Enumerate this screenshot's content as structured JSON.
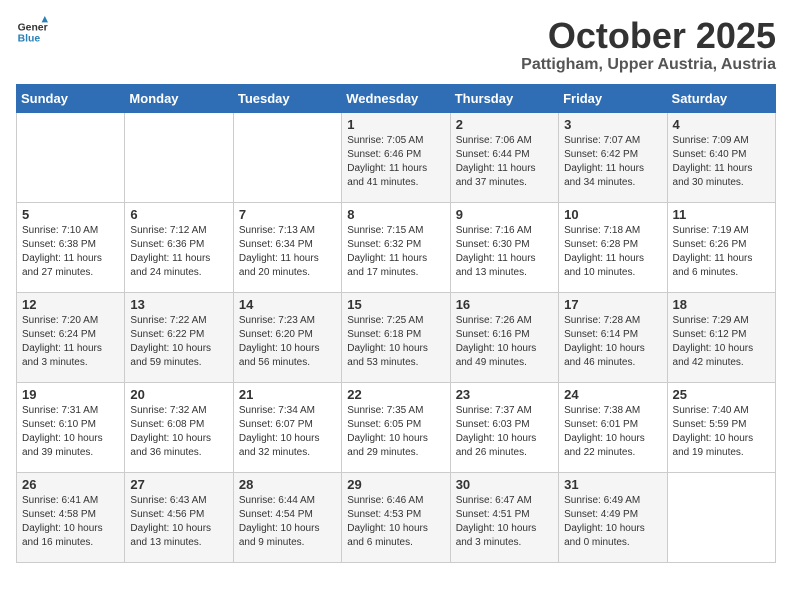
{
  "header": {
    "logo_line1": "General",
    "logo_line2": "Blue",
    "title": "October 2025",
    "subtitle": "Pattigham, Upper Austria, Austria"
  },
  "weekdays": [
    "Sunday",
    "Monday",
    "Tuesday",
    "Wednesday",
    "Thursday",
    "Friday",
    "Saturday"
  ],
  "weeks": [
    [
      {
        "day": "",
        "info": ""
      },
      {
        "day": "",
        "info": ""
      },
      {
        "day": "",
        "info": ""
      },
      {
        "day": "1",
        "info": "Sunrise: 7:05 AM\nSunset: 6:46 PM\nDaylight: 11 hours\nand 41 minutes."
      },
      {
        "day": "2",
        "info": "Sunrise: 7:06 AM\nSunset: 6:44 PM\nDaylight: 11 hours\nand 37 minutes."
      },
      {
        "day": "3",
        "info": "Sunrise: 7:07 AM\nSunset: 6:42 PM\nDaylight: 11 hours\nand 34 minutes."
      },
      {
        "day": "4",
        "info": "Sunrise: 7:09 AM\nSunset: 6:40 PM\nDaylight: 11 hours\nand 30 minutes."
      }
    ],
    [
      {
        "day": "5",
        "info": "Sunrise: 7:10 AM\nSunset: 6:38 PM\nDaylight: 11 hours\nand 27 minutes."
      },
      {
        "day": "6",
        "info": "Sunrise: 7:12 AM\nSunset: 6:36 PM\nDaylight: 11 hours\nand 24 minutes."
      },
      {
        "day": "7",
        "info": "Sunrise: 7:13 AM\nSunset: 6:34 PM\nDaylight: 11 hours\nand 20 minutes."
      },
      {
        "day": "8",
        "info": "Sunrise: 7:15 AM\nSunset: 6:32 PM\nDaylight: 11 hours\nand 17 minutes."
      },
      {
        "day": "9",
        "info": "Sunrise: 7:16 AM\nSunset: 6:30 PM\nDaylight: 11 hours\nand 13 minutes."
      },
      {
        "day": "10",
        "info": "Sunrise: 7:18 AM\nSunset: 6:28 PM\nDaylight: 11 hours\nand 10 minutes."
      },
      {
        "day": "11",
        "info": "Sunrise: 7:19 AM\nSunset: 6:26 PM\nDaylight: 11 hours\nand 6 minutes."
      }
    ],
    [
      {
        "day": "12",
        "info": "Sunrise: 7:20 AM\nSunset: 6:24 PM\nDaylight: 11 hours\nand 3 minutes."
      },
      {
        "day": "13",
        "info": "Sunrise: 7:22 AM\nSunset: 6:22 PM\nDaylight: 10 hours\nand 59 minutes."
      },
      {
        "day": "14",
        "info": "Sunrise: 7:23 AM\nSunset: 6:20 PM\nDaylight: 10 hours\nand 56 minutes."
      },
      {
        "day": "15",
        "info": "Sunrise: 7:25 AM\nSunset: 6:18 PM\nDaylight: 10 hours\nand 53 minutes."
      },
      {
        "day": "16",
        "info": "Sunrise: 7:26 AM\nSunset: 6:16 PM\nDaylight: 10 hours\nand 49 minutes."
      },
      {
        "day": "17",
        "info": "Sunrise: 7:28 AM\nSunset: 6:14 PM\nDaylight: 10 hours\nand 46 minutes."
      },
      {
        "day": "18",
        "info": "Sunrise: 7:29 AM\nSunset: 6:12 PM\nDaylight: 10 hours\nand 42 minutes."
      }
    ],
    [
      {
        "day": "19",
        "info": "Sunrise: 7:31 AM\nSunset: 6:10 PM\nDaylight: 10 hours\nand 39 minutes."
      },
      {
        "day": "20",
        "info": "Sunrise: 7:32 AM\nSunset: 6:08 PM\nDaylight: 10 hours\nand 36 minutes."
      },
      {
        "day": "21",
        "info": "Sunrise: 7:34 AM\nSunset: 6:07 PM\nDaylight: 10 hours\nand 32 minutes."
      },
      {
        "day": "22",
        "info": "Sunrise: 7:35 AM\nSunset: 6:05 PM\nDaylight: 10 hours\nand 29 minutes."
      },
      {
        "day": "23",
        "info": "Sunrise: 7:37 AM\nSunset: 6:03 PM\nDaylight: 10 hours\nand 26 minutes."
      },
      {
        "day": "24",
        "info": "Sunrise: 7:38 AM\nSunset: 6:01 PM\nDaylight: 10 hours\nand 22 minutes."
      },
      {
        "day": "25",
        "info": "Sunrise: 7:40 AM\nSunset: 5:59 PM\nDaylight: 10 hours\nand 19 minutes."
      }
    ],
    [
      {
        "day": "26",
        "info": "Sunrise: 6:41 AM\nSunset: 4:58 PM\nDaylight: 10 hours\nand 16 minutes."
      },
      {
        "day": "27",
        "info": "Sunrise: 6:43 AM\nSunset: 4:56 PM\nDaylight: 10 hours\nand 13 minutes."
      },
      {
        "day": "28",
        "info": "Sunrise: 6:44 AM\nSunset: 4:54 PM\nDaylight: 10 hours\nand 9 minutes."
      },
      {
        "day": "29",
        "info": "Sunrise: 6:46 AM\nSunset: 4:53 PM\nDaylight: 10 hours\nand 6 minutes."
      },
      {
        "day": "30",
        "info": "Sunrise: 6:47 AM\nSunset: 4:51 PM\nDaylight: 10 hours\nand 3 minutes."
      },
      {
        "day": "31",
        "info": "Sunrise: 6:49 AM\nSunset: 4:49 PM\nDaylight: 10 hours\nand 0 minutes."
      },
      {
        "day": "",
        "info": ""
      }
    ]
  ]
}
